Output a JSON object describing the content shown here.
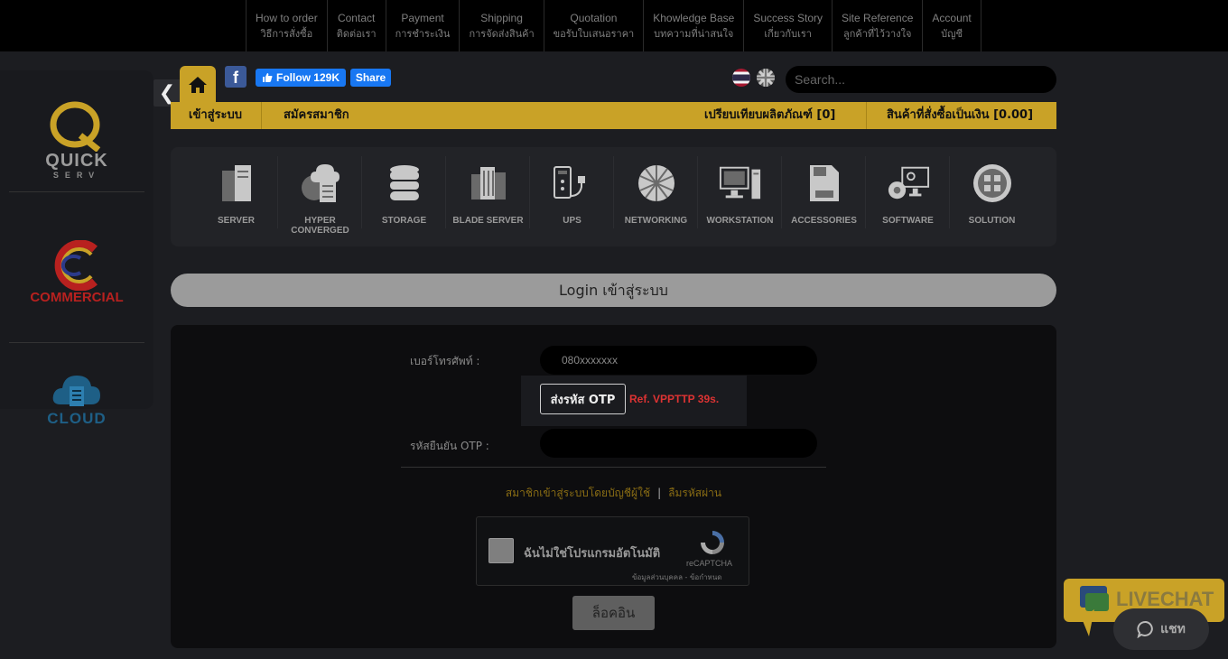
{
  "topnav": [
    {
      "en": "How to order",
      "th": "วิธีการสั่งซื้อ"
    },
    {
      "en": "Contact",
      "th": "ติดต่อเรา"
    },
    {
      "en": "Payment",
      "th": "การชำระเงิน"
    },
    {
      "en": "Shipping",
      "th": "การจัดส่งสินค้า"
    },
    {
      "en": "Quotation",
      "th": "ขอรับใบเสนอราคา"
    },
    {
      "en": "Khowledge Base",
      "th": "บทความที่น่าสนใจ"
    },
    {
      "en": "Success Story",
      "th": "เกี่ยวกับเรา"
    },
    {
      "en": "Site Reference",
      "th": "ลูกค้าที่ไว้วางใจ"
    },
    {
      "en": "Account",
      "th": "บัญชี"
    }
  ],
  "brands": {
    "quick": {
      "main": "QUICK",
      "sub": "SERV"
    },
    "commercial": "COMMERCIAL",
    "cloud": "CLOUD"
  },
  "social": {
    "fb_letter": "f",
    "follow": "Follow 129K",
    "share": "Share"
  },
  "search": {
    "placeholder": "Search..."
  },
  "goldbar": {
    "login": "เข้าสู่ระบบ",
    "register": "สมัครสมาชิก",
    "compare": "เปรียบเทียบผลิตภัณฑ์ [0]",
    "cart": "สินค้าที่สั่งซื้อเป็นเงิน [0.00]"
  },
  "categories": [
    {
      "label": "SERVER",
      "icon": "server-rack-icon"
    },
    {
      "label": "HYPER\nCONVERGED",
      "icon": "hyper-converged-icon"
    },
    {
      "label": "STORAGE",
      "icon": "storage-icon"
    },
    {
      "label": "BLADE SERVER",
      "icon": "blade-server-icon"
    },
    {
      "label": "UPS",
      "icon": "ups-icon"
    },
    {
      "label": "NETWORKING",
      "icon": "networking-icon"
    },
    {
      "label": "WORKSTATION",
      "icon": "workstation-icon"
    },
    {
      "label": "ACCESSORIES",
      "icon": "accessories-icon"
    },
    {
      "label": "SOFTWARE",
      "icon": "software-icon"
    },
    {
      "label": "SOLUTION",
      "icon": "solution-icon"
    }
  ],
  "login": {
    "title": "Login เข้าสู่ระบบ",
    "phone_label": "เบอร์โทรศัพท์ :",
    "phone_value": "080xxxxxxx",
    "otp_button": "ส่งรหัส OTP",
    "otp_ref": "Ref. VPPTTP 39s.",
    "otp_label": "รหัสยืนยัน OTP :",
    "otp_value": "",
    "member_link": "สมาชิกเข้าสู่ระบบโดยบัญชีผู้ใช้",
    "separator": "|",
    "forgot_link": "ลืมรหัสผ่าน",
    "submit": "ล็อคอิน"
  },
  "captcha": {
    "label": "ฉันไม่ใช่โปรแกรมอัตโนมัติ",
    "brand": "reCAPTCHA",
    "terms": "ข้อมูลส่วนบุคคล - ข้อกำหนด"
  },
  "livechat": {
    "banner": "LIVECHAT",
    "chat": "แชท"
  },
  "colors": {
    "gold": "#c9a227",
    "facebook": "#1877f2",
    "ref_red": "#dd3333"
  }
}
